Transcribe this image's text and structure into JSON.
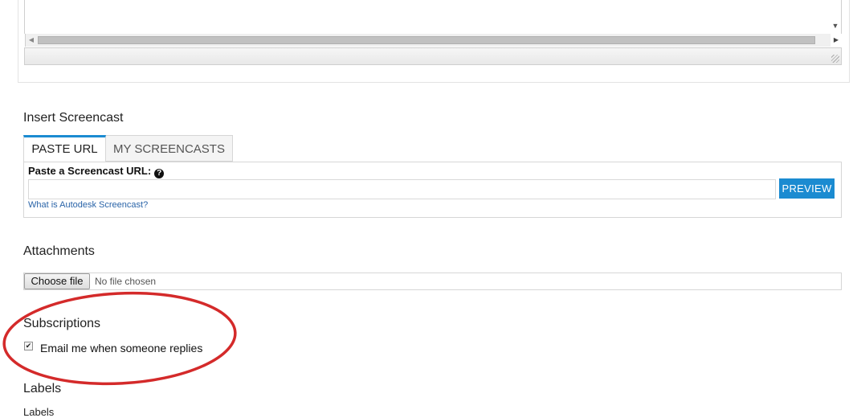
{
  "editor": {
    "vscroll_arrow": "▼",
    "hscroll_left": "◀",
    "hscroll_right": "▶"
  },
  "screencast": {
    "heading": "Insert Screencast",
    "tabs": [
      {
        "label": "PASTE URL",
        "active": true
      },
      {
        "label": "MY SCREENCASTS",
        "active": false
      }
    ],
    "url_label": "Paste a Screencast URL:",
    "help_icon": "?",
    "url_value": "",
    "url_placeholder": "",
    "preview_label": "PREVIEW",
    "info_link": "What is Autodesk Screencast?"
  },
  "attachments": {
    "heading": "Attachments",
    "choose_label": "Choose file",
    "status": "No file chosen"
  },
  "subscriptions": {
    "heading": "Subscriptions",
    "email_label": "Email me when someone replies",
    "checked": true,
    "check_glyph": "✔"
  },
  "labels": {
    "heading": "Labels",
    "field_label": "Labels"
  },
  "colors": {
    "accent": "#1b8bd1",
    "annotation": "#d42a2a",
    "link": "#2a64a8"
  }
}
